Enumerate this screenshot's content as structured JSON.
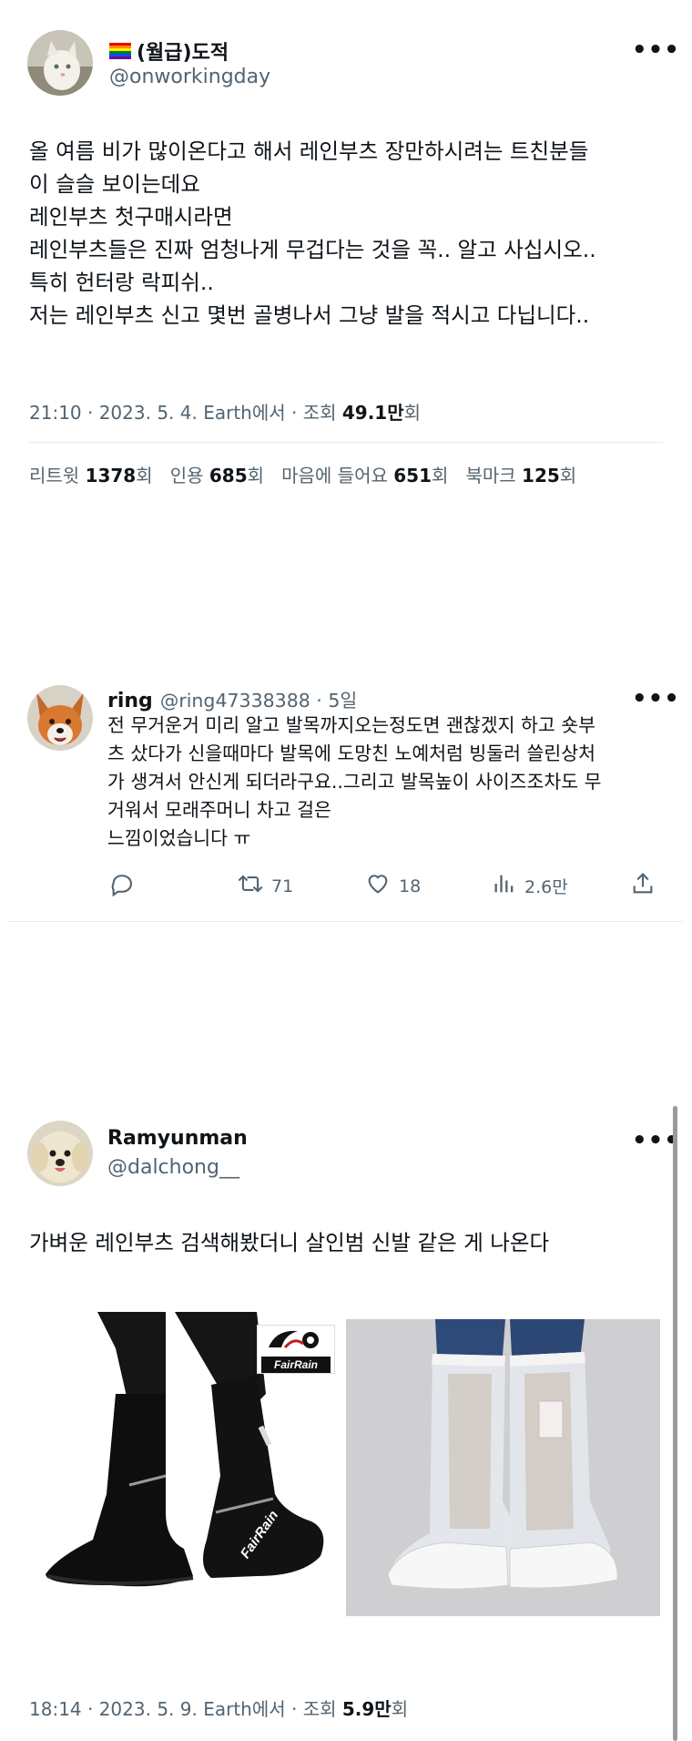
{
  "tweet1": {
    "flag": "🏳️‍🌈",
    "name": "(월급)도적",
    "handle": "@onworkingday",
    "more": "•••",
    "lines": [
      "올 여름 비가 많이온다고 해서 레인부츠 장만하시려는 트친분들",
      "이 슬슬 보이는데요",
      "레인부츠 첫구매시라면",
      "레인부츠들은 진짜 엄청나게 무겁다는 것을 꼭.. 알고 사십시오..",
      "특히 헌터랑 락피쉬..",
      "저는 레인부츠 신고 몇번 골병나서 그냥 발을 적시고 다닙니다.."
    ],
    "meta_prefix": "21:10 · 2023. 5. 4. Earth에서 · 조회 ",
    "views": "49.1만",
    "views_suffix": "회",
    "stats": {
      "retweet_label": "리트윗 ",
      "retweet": "1378",
      "retweet_unit": "회",
      "quote_label": "인용 ",
      "quote": "685",
      "quote_unit": "회",
      "like_label": "마음에 들어요 ",
      "like": "651",
      "like_unit": "회",
      "bookmark_label": "북마크 ",
      "bookmark": "125",
      "bookmark_unit": "회"
    }
  },
  "reply": {
    "name": "ring",
    "handle": "@ring47338388 · 5일",
    "more": "•••",
    "lines": [
      "전 무거운거 미리 알고 발목까지오는정도면 괜찮겠지 하고 숏부",
      "츠 샀다가 신을때마다 발목에 도망친 노예처럼 빙둘러 쓸린상처",
      "가 생겨서 안신게 되더라구요..그리고 발목높이 사이즈조차도 무",
      "거워서 모래주머니 차고 걸은",
      "느낌이었습니다 ㅠ"
    ],
    "actions": {
      "retweets": "71",
      "likes": "18",
      "views": "2.6만"
    }
  },
  "tweet2": {
    "name": "Ramyunman",
    "handle": "@dalchong__",
    "more": "•••",
    "text": "가벼운 레인부츠 검색해봤더니 살인범 신발 같은 게 나온다",
    "brand_logo": "FairRain",
    "boot_brand": "FairRain",
    "meta_prefix": "18:14 · 2023. 5. 9. Earth에서 · 조회 ",
    "views": "5.9만",
    "views_suffix": "회"
  },
  "colors": {
    "text": "#0f1419",
    "secondary": "#536471",
    "divider": "#e6ecf0"
  }
}
